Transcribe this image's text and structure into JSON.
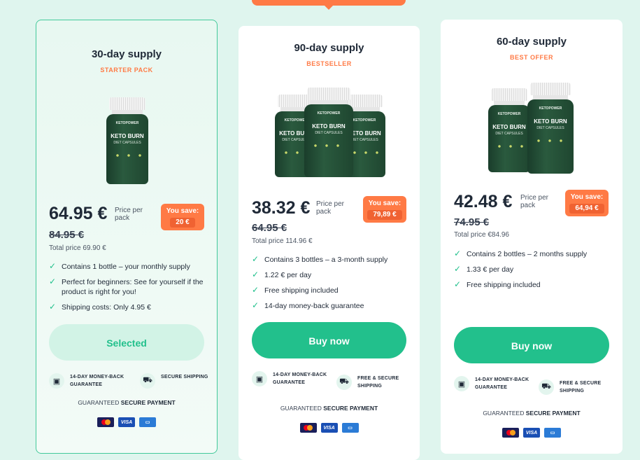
{
  "plans": [
    {
      "title": "30-day supply",
      "tag": "STARTER PACK",
      "price": "64.95 €",
      "price_per_pack": "Price per pack",
      "you_save_label": "You save:",
      "you_save_amount": "20 €",
      "old_price": "84.95 €",
      "total_price": "Total price 69.90 €",
      "features": [
        "Contains 1 bottle – your monthly supply",
        "Perfect for beginners: See for yourself if the product is right for you!",
        "Shipping costs: Only 4.95 €"
      ],
      "button": "Selected",
      "guarantee_1": "14-DAY MONEY-BACK GUARANTEE",
      "guarantee_2": "SECURE SHIPPING"
    },
    {
      "title": "90-day supply",
      "tag": "BESTSELLER",
      "price": "38.32 €",
      "price_per_pack": "Price per pack",
      "you_save_label": "You save:",
      "you_save_amount": "79,89 €",
      "old_price": "64.95 €",
      "total_price": "Total price 114.96 €",
      "features": [
        "Contains 3 bottles – a 3-month supply",
        "1.22 € per day",
        "Free shipping included",
        "14-day money-back guarantee"
      ],
      "button": "Buy now",
      "guarantee_1": "14-DAY MONEY-BACK GUARANTEE",
      "guarantee_2": "FREE & SECURE SHIPPING"
    },
    {
      "title": "60-day supply",
      "tag": "BEST OFFER",
      "price": "42.48 €",
      "price_per_pack": "Price per pack",
      "you_save_label": "You save:",
      "you_save_amount": "64,94 €",
      "old_price": "74.95 €",
      "total_price": "Total price €84.96",
      "features": [
        "Contains 2 bottles – 2 months supply",
        "1.33 € per day",
        "Free shipping included"
      ],
      "button": "Buy now",
      "guarantee_1": "14-DAY MONEY-BACK GUARANTEE",
      "guarantee_2": "FREE & SECURE SHIPPING"
    }
  ],
  "secure_payment_prefix": "GUARANTEED",
  "secure_payment_bold": "SECURE PAYMENT",
  "product": {
    "brand": "KETOPOWER",
    "name_line1": "KETO BURN",
    "name_line2": "DIET CAPSULES"
  },
  "payment_methods": [
    "mastercard",
    "VISA",
    "amex"
  ],
  "icons": {
    "feature": "check-icon",
    "guarantee": "wallet-icon",
    "shipping": "truck-icon"
  },
  "colors": {
    "accent": "#22c08c",
    "badge": "#ff7a45",
    "background": "#dff5ee"
  }
}
